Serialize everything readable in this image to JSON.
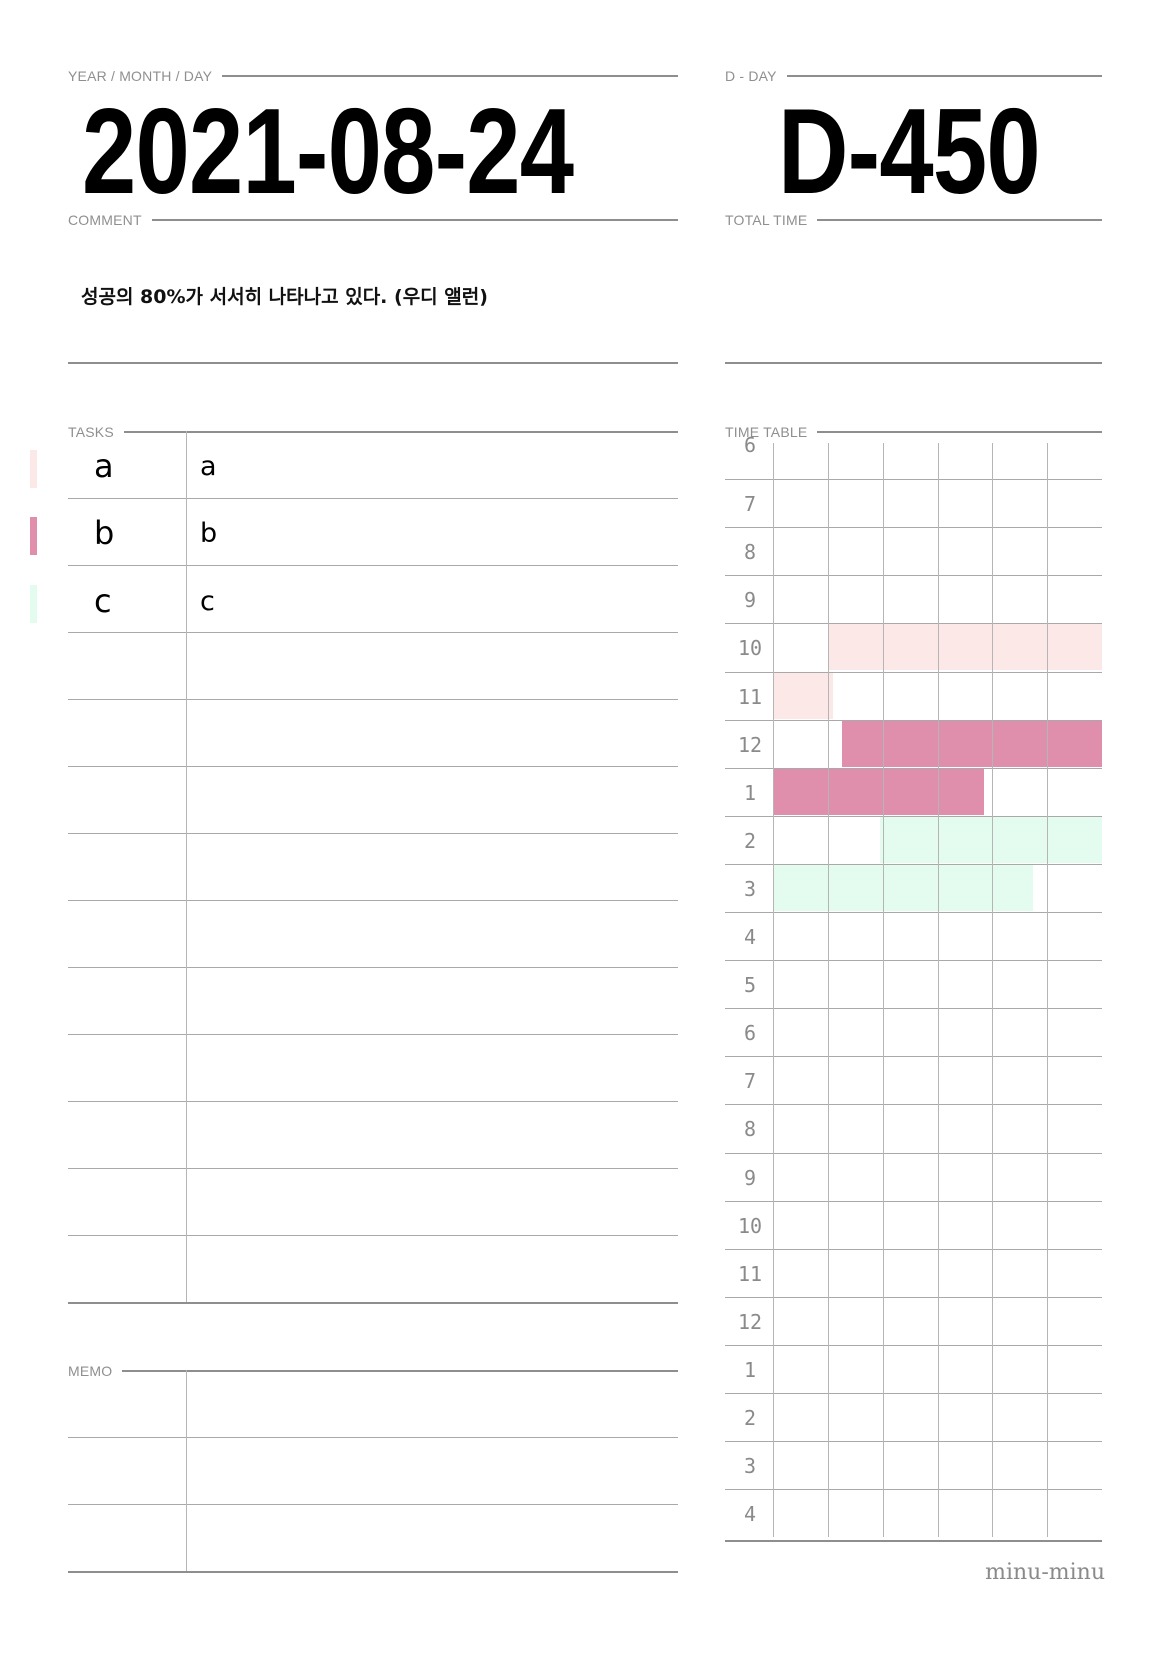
{
  "header": {
    "date_label": "YEAR / MONTH / DAY",
    "date": "2021-08-24",
    "dday_label": "D - DAY",
    "dday": "D-450",
    "comment_label": "COMMENT",
    "total_time_label": "TOTAL TIME"
  },
  "comment": {
    "text": "성공의 80%가 서서히 나타나고 있다. (우디 앨런)"
  },
  "tasks": {
    "label": "TASKS",
    "items": [
      {
        "code": "a",
        "name": "a",
        "color": "#fde8e8"
      },
      {
        "code": "b",
        "name": "b",
        "color": "#df8fab"
      },
      {
        "code": "c",
        "name": "c",
        "color": "#e4fbf0"
      }
    ]
  },
  "memo": {
    "label": "MEMO"
  },
  "timetable": {
    "label": "TIME TABLE",
    "hours": [
      "6",
      "7",
      "8",
      "9",
      "10",
      "11",
      "12",
      "1",
      "2",
      "3",
      "4",
      "5",
      "6",
      "7",
      "8",
      "9",
      "10",
      "11",
      "12",
      "1",
      "2",
      "3",
      "4"
    ],
    "slots_per_hour": 6,
    "blocks": [
      {
        "task": "a",
        "start_hour_index": 4,
        "start_slot": 1,
        "end_hour_index": 5,
        "end_slot": 1.1
      },
      {
        "task": "b",
        "start_hour_index": 6,
        "start_slot": 1.25,
        "end_hour_index": 7,
        "end_slot": 3.85
      },
      {
        "task": "c",
        "start_hour_index": 8,
        "start_slot": 1.95,
        "end_hour_index": 9,
        "end_slot": 4.75
      }
    ]
  },
  "brand": {
    "text": "minu-minu"
  }
}
